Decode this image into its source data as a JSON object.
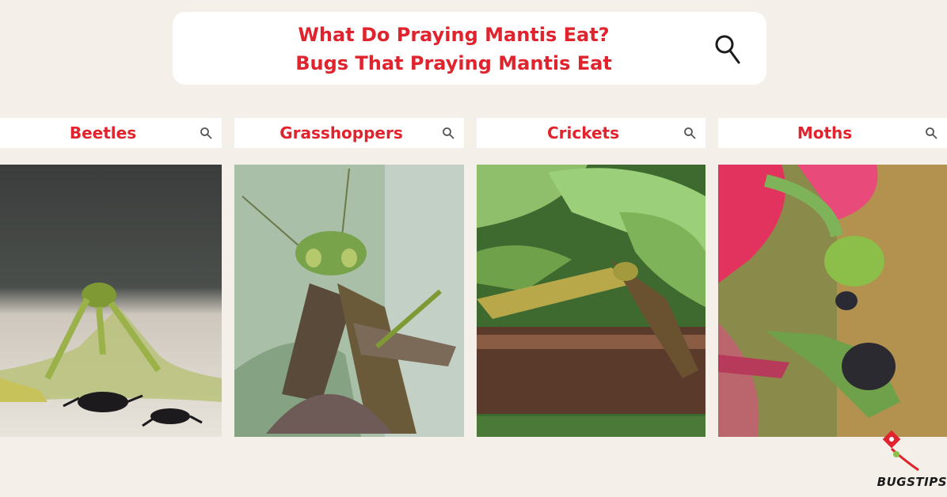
{
  "search": {
    "title_line1": "What Do Praying Mantis Eat?",
    "title_line2": "Bugs That Praying Mantis Eat",
    "icon": "search-icon"
  },
  "cards": [
    {
      "label": "Beetles",
      "icon": "search-icon"
    },
    {
      "label": "Grasshoppers",
      "icon": "search-icon"
    },
    {
      "label": "Crickets",
      "icon": "search-icon"
    },
    {
      "label": "Moths",
      "icon": "search-icon"
    }
  ],
  "logo": {
    "text": "BUGSTIPS"
  },
  "colors": {
    "accent": "#e0232d",
    "background": "#f4efe9",
    "card": "#ffffff"
  }
}
